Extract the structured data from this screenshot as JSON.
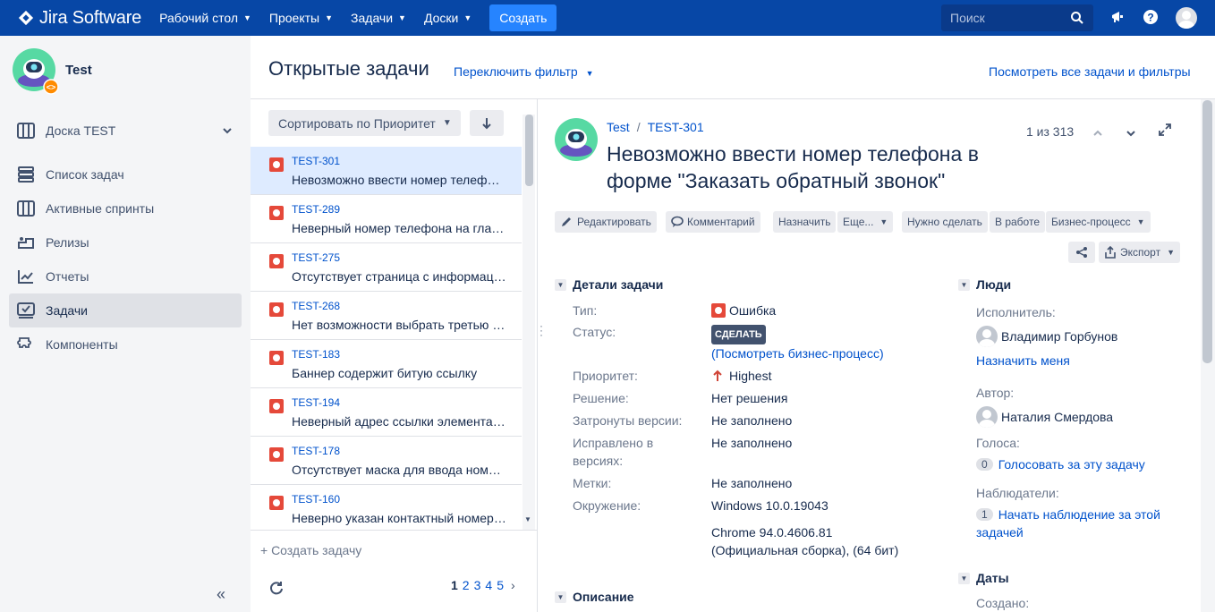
{
  "topnav": {
    "brand": "Jira Software",
    "items": [
      "Рабочий стол",
      "Проекты",
      "Задачи",
      "Доски"
    ],
    "create_label": "Создать",
    "search_placeholder": "Поиск"
  },
  "sidebar": {
    "project_name": "Test",
    "board_label": "Доска TEST",
    "items": [
      {
        "label": "Список задач",
        "icon": "backlog-icon"
      },
      {
        "label": "Активные спринты",
        "icon": "sprints-icon"
      },
      {
        "label": "Релизы",
        "icon": "releases-icon"
      },
      {
        "label": "Отчеты",
        "icon": "reports-icon"
      },
      {
        "label": "Задачи",
        "icon": "issues-icon",
        "active": true
      },
      {
        "label": "Компоненты",
        "icon": "components-icon"
      }
    ]
  },
  "header": {
    "title": "Открытые задачи",
    "switch_filter": "Переключить фильтр",
    "all_link": "Посмотреть все задачи и фильтры"
  },
  "list": {
    "sort_label": "Сортировать по Приоритет",
    "items": [
      {
        "key": "TEST-301",
        "summary": "Невозможно ввести номер телефона в форме \"Заказать обратный звонок\""
      },
      {
        "key": "TEST-289",
        "summary": "Неверный номер телефона на главной странице"
      },
      {
        "key": "TEST-275",
        "summary": "Отсутствует страница с информацией"
      },
      {
        "key": "TEST-268",
        "summary": "Нет возможности выбрать третью опцию"
      },
      {
        "key": "TEST-183",
        "summary": "Баннер содержит битую ссылку"
      },
      {
        "key": "TEST-194",
        "summary": "Неверный адрес ссылки элемента меню"
      },
      {
        "key": "TEST-178",
        "summary": "Отсутствует маска для ввода номера телефона"
      },
      {
        "key": "TEST-160",
        "summary": "Неверно указан контактный номер телефона"
      }
    ],
    "create_issue": "+ Создать задачу",
    "pages": [
      "1",
      "2",
      "3",
      "4",
      "5"
    ]
  },
  "detail": {
    "breadcrumb_project": "Test",
    "breadcrumb_sep": "/",
    "breadcrumb_key": "TEST-301",
    "title": "Невозможно ввести номер телефона в форме \"Заказать обратный звонок\"",
    "counter": "1 из 313",
    "toolbar": {
      "edit": "Редактировать",
      "comment": "Комментарий",
      "assign": "Назначить",
      "more": "Еще...",
      "todo": "Нужно сделать",
      "in_progress": "В работе",
      "workflow": "Бизнес-процесс",
      "export": "Экспорт"
    },
    "details_heading": "Детали задачи",
    "fields": {
      "type_label": "Тип:",
      "type_value": "Ошибка",
      "status_label": "Статус:",
      "status_value": "СДЕЛАТЬ",
      "workflow_link": "(Посмотреть бизнес-процесс)",
      "priority_label": "Приоритет:",
      "priority_value": "Highest",
      "resolution_label": "Решение:",
      "resolution_value": "Нет решения",
      "affects_label": "Затронуты версии:",
      "affects_value": "Не заполнено",
      "fix_label_1": "Исправлено в",
      "fix_label_2": "версиях:",
      "fix_value": "Не заполнено",
      "labels_label": "Метки:",
      "labels_value": "Не заполнено",
      "env_label": "Окружение:",
      "env_line1": "Windows 10.0.19043",
      "env_line2": "Chrome 94.0.4606.81",
      "env_line3": "(Официальная сборка), (64 бит)"
    },
    "description_heading": "Описание",
    "people": {
      "heading": "Люди",
      "assignee_label": "Исполнитель:",
      "assignee": "Владимир Горбунов",
      "assign_me": "Назначить меня",
      "reporter_label": "Автор:",
      "reporter": "Наталия Смердова",
      "votes_label": "Голоса:",
      "votes_count": "0",
      "vote_link": "Голосовать за эту задачу",
      "watchers_label": "Наблюдатели:",
      "watchers_count": "1",
      "watch_link_1": "Начать наблюдение за этой",
      "watch_link_2": "задачей"
    },
    "dates": {
      "heading": "Даты",
      "created_label": "Создано:"
    }
  },
  "colors": {
    "nav_bg": "#0747a6",
    "create_bg": "#2684ff",
    "link": "#0052cc",
    "bug": "#e5493a",
    "priority_highest": "#d04437",
    "selected_row": "#deebff"
  }
}
